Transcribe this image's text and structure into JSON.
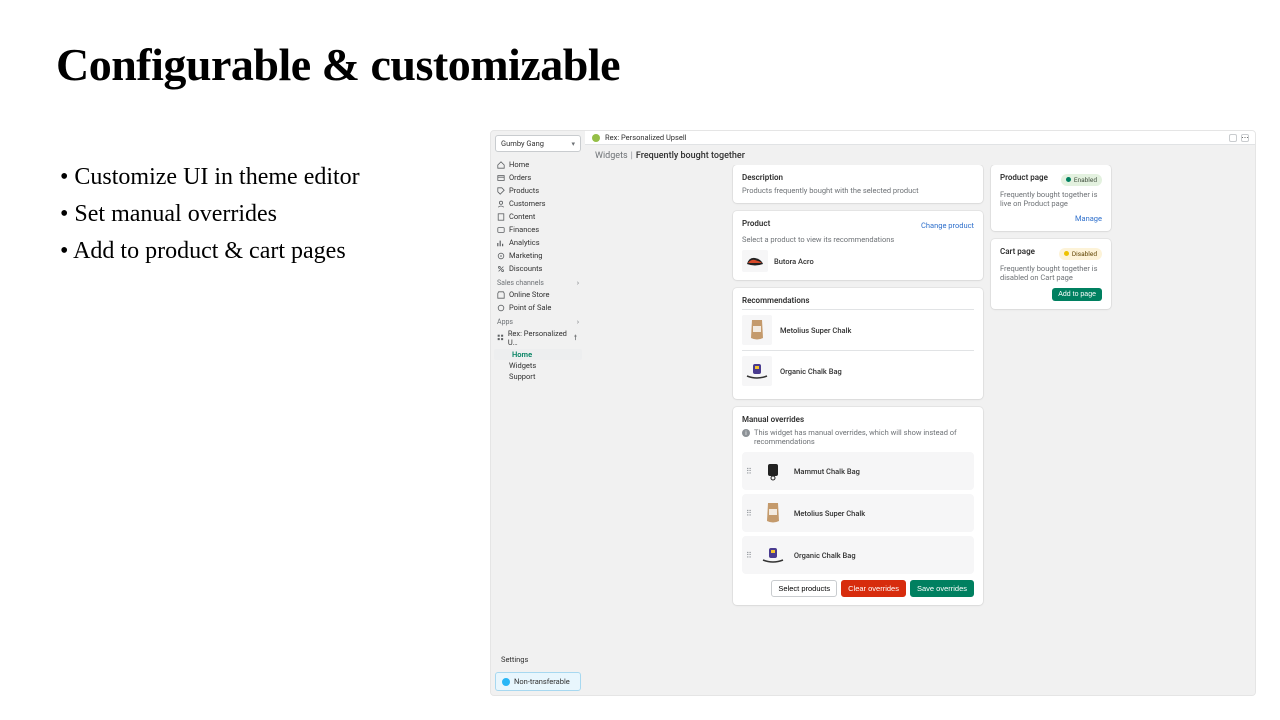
{
  "hero": {
    "title": "Configurable & customizable",
    "bullets": [
      "Customize UI in theme editor",
      "Set manual overrides",
      "Add to product & cart pages"
    ]
  },
  "store_selector": "Gumby Gang",
  "app_header": "Rex: Personalized Upsell",
  "nav": {
    "home": "Home",
    "orders": "Orders",
    "products": "Products",
    "customers": "Customers",
    "content": "Content",
    "finances": "Finances",
    "analytics": "Analytics",
    "marketing": "Marketing",
    "discounts": "Discounts"
  },
  "sales_channels": {
    "title": "Sales channels",
    "online_store": "Online Store",
    "pos": "Point of Sale"
  },
  "apps": {
    "title": "Apps",
    "rex": "Rex: Personalized U…",
    "sub_home": "Home",
    "sub_widgets": "Widgets",
    "sub_support": "Support"
  },
  "settings": "Settings",
  "nontransferable": "Non-transferable",
  "breadcrumb": {
    "widgets": "Widgets",
    "current": "Frequently bought together"
  },
  "description": {
    "title": "Description",
    "text": "Products frequently bought with the selected product"
  },
  "product": {
    "title": "Product",
    "change": "Change product",
    "hint": "Select a product to view its recommendations",
    "selected": "Butora Acro"
  },
  "recommendations": {
    "title": "Recommendations",
    "items": [
      "Metolius Super Chalk",
      "Organic Chalk Bag"
    ]
  },
  "overrides": {
    "title": "Manual overrides",
    "info": "This widget has manual overrides, which will show instead of recommendations",
    "items": [
      "Mammut Chalk Bag",
      "Metolius Super Chalk",
      "Organic Chalk Bag"
    ],
    "btn_select": "Select products",
    "btn_clear": "Clear overrides",
    "btn_save": "Save overrides"
  },
  "product_page": {
    "title": "Product page",
    "badge": "Enabled",
    "text": "Frequently bought together is live on Product page",
    "action": "Manage"
  },
  "cart_page": {
    "title": "Cart page",
    "badge": "Disabled",
    "text": "Frequently bought together is disabled on Cart page",
    "action": "Add to page"
  }
}
